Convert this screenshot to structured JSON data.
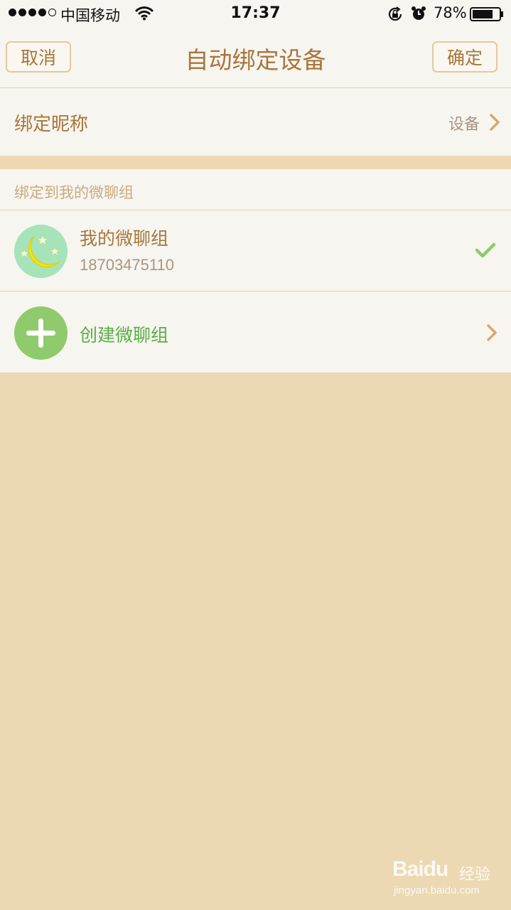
{
  "status_bar": {
    "carrier": "中国移动",
    "time": "17:37",
    "battery_percent": "78%",
    "signal_bars_filled": 4,
    "signal_bars_total": 5,
    "battery_level": 0.78,
    "icons": [
      "signal-dots",
      "wifi-icon",
      "orientation-lock-icon",
      "alarm-icon",
      "battery-icon"
    ]
  },
  "nav": {
    "cancel_label": "取消",
    "title": "自动绑定设备",
    "confirm_label": "确定"
  },
  "nickname": {
    "label": "绑定昵称",
    "value": "设备",
    "icon": "chevron-right-icon"
  },
  "group_section": {
    "header": "绑定到我的微聊组",
    "groups": [
      {
        "name": "我的微聊组",
        "number": "18703475110",
        "selected": true,
        "avatar_icon": "moon-stars-icon",
        "status_icon": "check-icon"
      }
    ],
    "create": {
      "label": "创建微聊组",
      "icon": "plus-icon"
    }
  },
  "watermark": {
    "logo": "Baidu",
    "suffix": "经验",
    "url": "jingyan.baidu.com"
  },
  "colors": {
    "page_background": "#ecd8b2",
    "panel_background": "#f7f5f0",
    "primary_text": "#a8763a",
    "secondary_text": "#a69682",
    "accent_green": "#56b042",
    "check_green": "#8fcb6c",
    "chevron": "#d9a96b",
    "avatar_background": "#a6e3b9"
  }
}
